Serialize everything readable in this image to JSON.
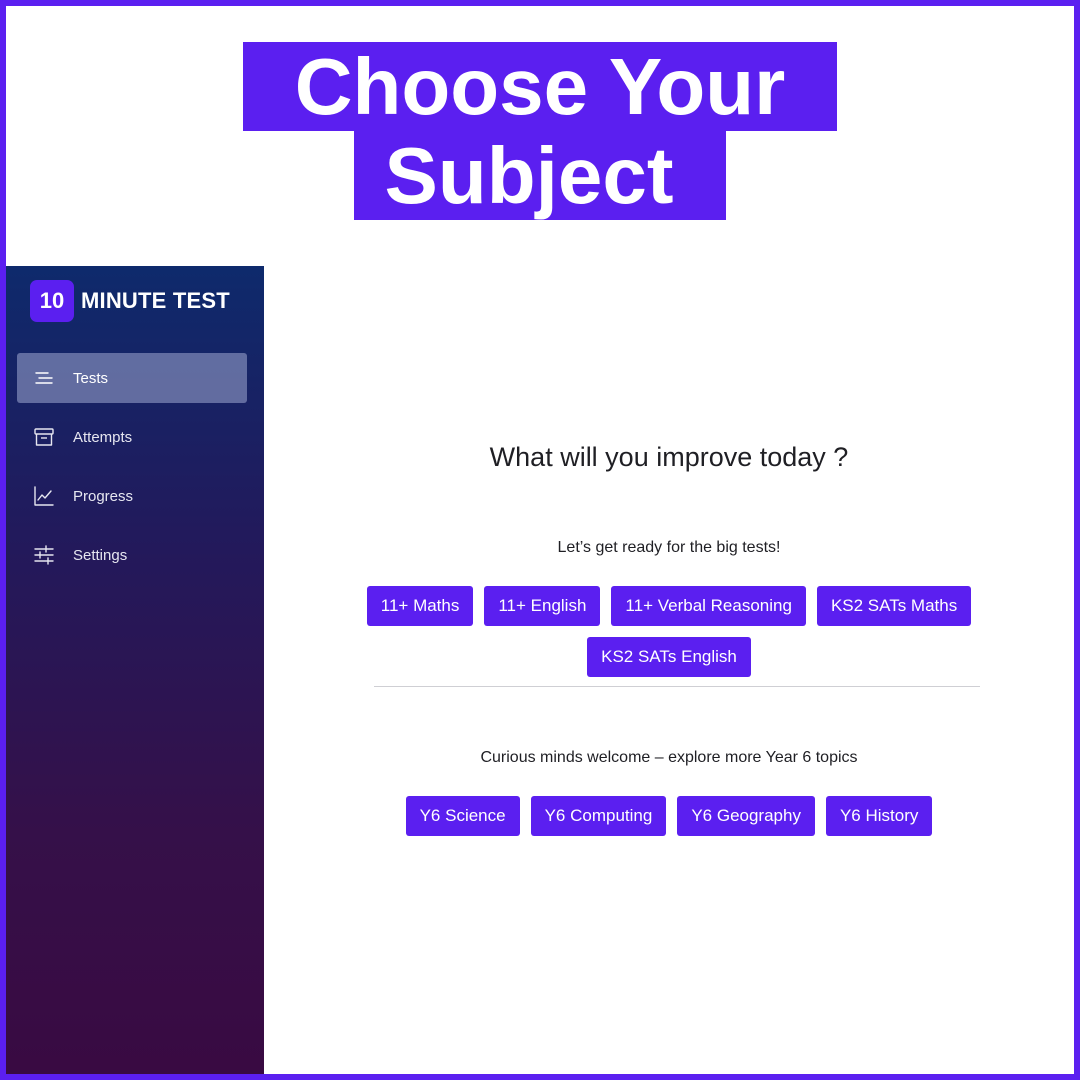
{
  "headline": {
    "line1": " Choose Your ",
    "line2": " Subject "
  },
  "brand": {
    "badge": "10",
    "name": "MINUTE TEST"
  },
  "sidebar": {
    "items": [
      {
        "label": "Tests",
        "icon": "list-icon",
        "active": true
      },
      {
        "label": "Attempts",
        "icon": "archive-icon",
        "active": false
      },
      {
        "label": "Progress",
        "icon": "chart-line-icon",
        "active": false
      },
      {
        "label": "Settings",
        "icon": "sliders-icon",
        "active": false
      }
    ]
  },
  "main": {
    "title": "What will you improve today ?",
    "section1": {
      "subtitle": "Let’s get ready for the big tests!",
      "subjects": [
        "11+ Maths",
        "11+ English",
        "11+ Verbal Reasoning",
        "KS2 SATs Maths",
        "KS2 SATs English"
      ]
    },
    "section2": {
      "subtitle": "Curious minds welcome – explore more Year 6 topics",
      "subjects": [
        "Y6 Science",
        "Y6 Computing",
        "Y6 Geography",
        "Y6 History"
      ]
    }
  },
  "colors": {
    "accent": "#5b1ff0",
    "sidebar_top": "#0e2a6c",
    "sidebar_bottom": "#390a42"
  }
}
